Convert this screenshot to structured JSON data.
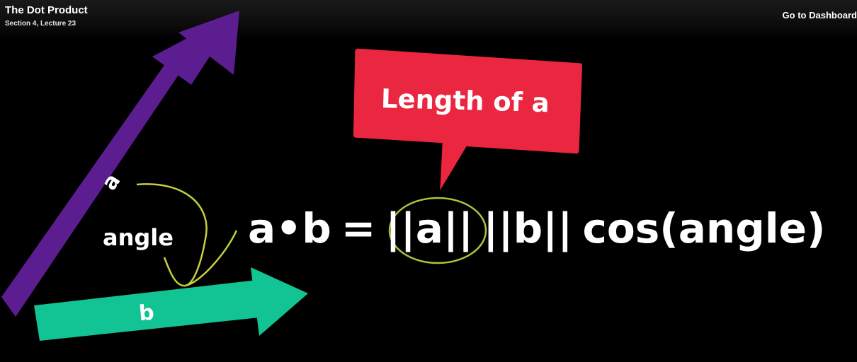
{
  "header": {
    "title": "The Dot Product",
    "subtitle": "Section 4, Lecture 23",
    "dashboard_link": "Go to Dashboard"
  },
  "slide": {
    "vector_a_label": "a",
    "vector_b_label": "b",
    "angle_label": "angle",
    "callout_label": "Length of a",
    "formula": {
      "lhs_a": "a",
      "dot": "•",
      "lhs_b": "b",
      "equals": "=",
      "norm_a": "||a||",
      "norm_b": "||b||",
      "cos": "cos(angle)"
    }
  },
  "colors": {
    "vector_a": "#5b1d8f",
    "vector_b": "#12c393",
    "callout": "#ea2640",
    "highlight": "#c6cf3c"
  }
}
